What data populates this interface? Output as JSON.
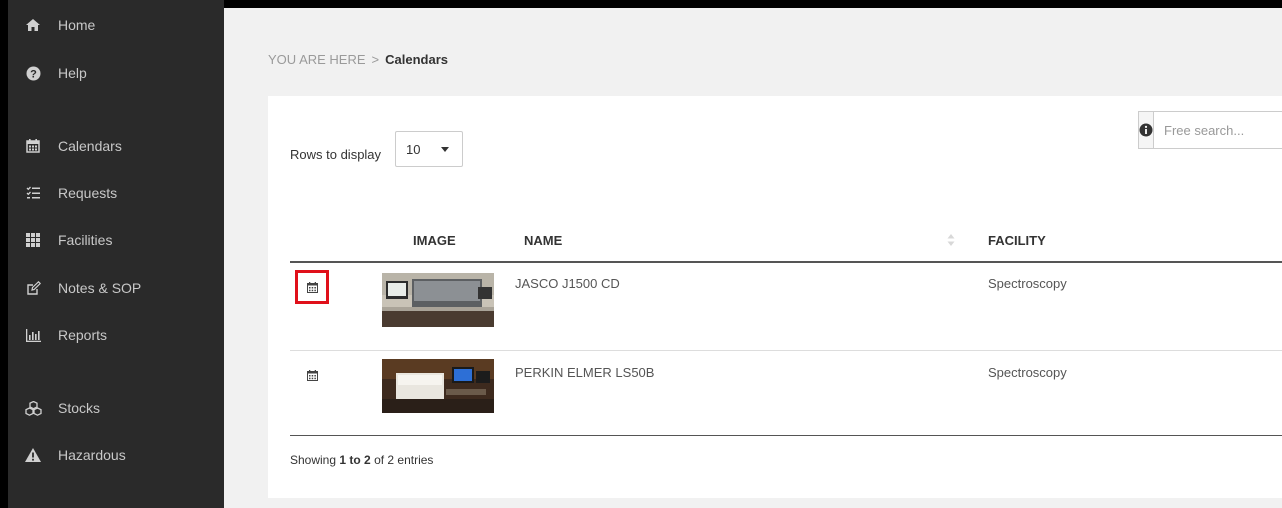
{
  "sidebar": {
    "items": [
      {
        "label": "Home",
        "icon": "home-icon"
      },
      {
        "label": "Help",
        "icon": "question-circle-icon"
      },
      {
        "label": "Calendars",
        "icon": "calendar-icon"
      },
      {
        "label": "Requests",
        "icon": "checklist-icon"
      },
      {
        "label": "Facilities",
        "icon": "grid-icon"
      },
      {
        "label": "Notes & SOP",
        "icon": "edit-icon"
      },
      {
        "label": "Reports",
        "icon": "bar-chart-icon"
      },
      {
        "label": "Stocks",
        "icon": "cubes-icon"
      },
      {
        "label": "Hazardous",
        "icon": "warning-icon"
      }
    ]
  },
  "breadcrumb": {
    "prefix": "YOU ARE HERE",
    "separator": ">",
    "current": "Calendars"
  },
  "table": {
    "rows_to_display_label": "Rows to display",
    "rows_to_display_value": "10",
    "search_placeholder": "Free search...",
    "columns": {
      "image": "IMAGE",
      "name": "NAME",
      "facility": "FACILITY"
    },
    "rows": [
      {
        "name": "JASCO J1500 CD",
        "facility": "Spectroscopy",
        "image": "instrument-photo-jasco",
        "highlighted": true
      },
      {
        "name": "PERKIN ELMER LS50B",
        "facility": "Spectroscopy",
        "image": "instrument-photo-perkin-elmer",
        "highlighted": false
      }
    ],
    "info": {
      "prefix": "Showing",
      "range": "1 to 2",
      "suffix": "of 2 entries"
    }
  },
  "colors": {
    "sidebar_bg": "#2a2a2a",
    "content_bg": "#f1f1f1",
    "highlight": "#e0101a"
  }
}
